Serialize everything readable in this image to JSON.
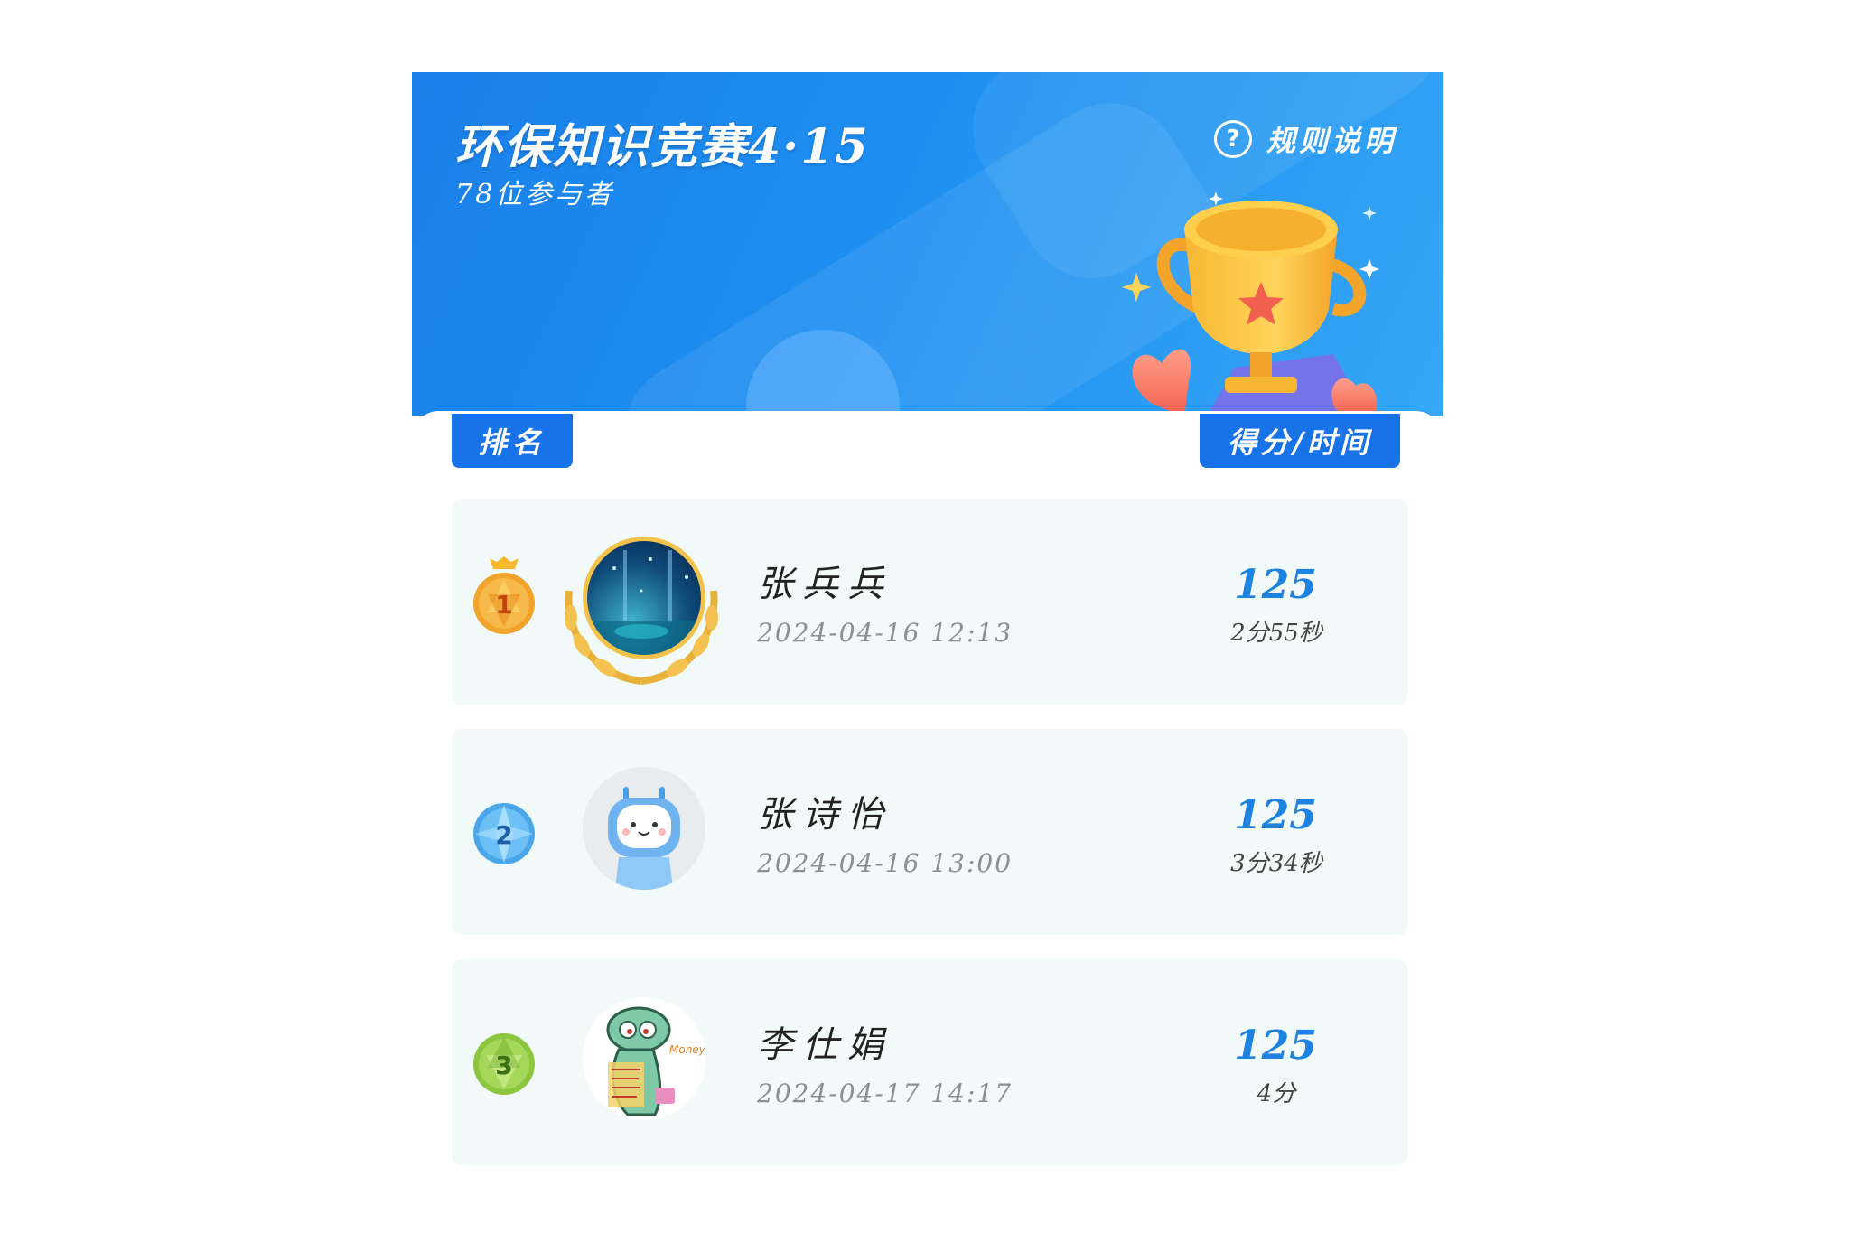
{
  "header": {
    "title": "环保知识竞赛4·15",
    "participants": "78位参与者",
    "rules_label": "规则说明",
    "rules_icon": "help-circle-icon"
  },
  "columns": {
    "rank": "排名",
    "score_time": "得分/时间"
  },
  "colors": {
    "banner": "#1e8ff0",
    "tab": "#1872e8",
    "row_bg": "#f1faf9",
    "score": "#1e82e0"
  },
  "rows": [
    {
      "rank": "1",
      "medal": "gold-medal-icon",
      "name": "张兵兵",
      "time": "2024-04-16 12:13",
      "score": "125",
      "duration": "2分55秒"
    },
    {
      "rank": "2",
      "medal": "silver-medal-icon",
      "name": "张诗怡",
      "time": "2024-04-16 13:00",
      "score": "125",
      "duration": "3分34秒"
    },
    {
      "rank": "3",
      "medal": "bronze-medal-icon",
      "name": "李仕娟",
      "time": "2024-04-17 14:17",
      "score": "125",
      "duration": "4分"
    }
  ]
}
